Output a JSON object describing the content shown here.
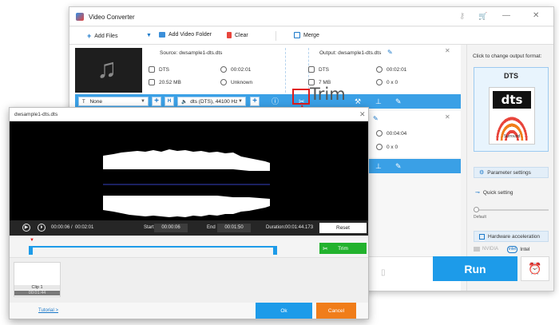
{
  "main": {
    "title": "Video Converter",
    "toolbar": {
      "add_files": "Add Files",
      "add_video_folder": "Add Video Folder",
      "clear": "Clear",
      "merge": "Merge"
    },
    "file1": {
      "source": "Source: dwsample1-dts.dts",
      "src_format": "DTS",
      "src_duration": "00:02:01",
      "src_size": "20.52 MB",
      "src_resolution": "Unknown",
      "output": "Output: dwsample1-dts.dts",
      "out_format": "DTS",
      "out_duration": "00:02:01",
      "out_size": "7 MB",
      "out_resolution": "0 x 0",
      "subtitle_select": "None",
      "audio_select": "dts (DTS), 44100 Hz"
    },
    "file2": {
      "out_duration": "00:04:04",
      "out_resolution": "0 x 0"
    },
    "right_panel": {
      "heading": "Click to change output format:",
      "format_name": "DTS",
      "format_logo_text": "dts",
      "format_logo_sub": "Surround",
      "parameter_settings": "Parameter settings",
      "quick_setting": "Quick setting",
      "default_label": "Default",
      "hardware_acceleration": "Hardware acceleration",
      "nvidia": "NVIDIA",
      "intel_logo": "intel",
      "intel": "Intel"
    },
    "run": "Run"
  },
  "trim_dialog": {
    "title": "dwsample1-dts.dts",
    "current_time": "00:00:06",
    "separator": "/",
    "total_time": "00:02:01",
    "start_label": "Start",
    "start_value": "00:00:06",
    "end_label": "End",
    "end_value": "00:01:50",
    "duration_label": "Duration:",
    "duration_value": "00:01:44.173",
    "reset": "Reset",
    "trim_button": "Trim",
    "clip_name": "Clip 1",
    "clip_duration": "00:01:44",
    "tutorial": "Tutorial >",
    "ok": "Ok",
    "cancel": "Cancel"
  },
  "callout": {
    "label": "Trim"
  },
  "colors": {
    "accent_blue": "#1d9be9",
    "editbar_blue": "#3aa0e6",
    "trim_green": "#22b22d",
    "cancel_orange": "#f07d1a",
    "callout_red": "#e01b1b"
  }
}
